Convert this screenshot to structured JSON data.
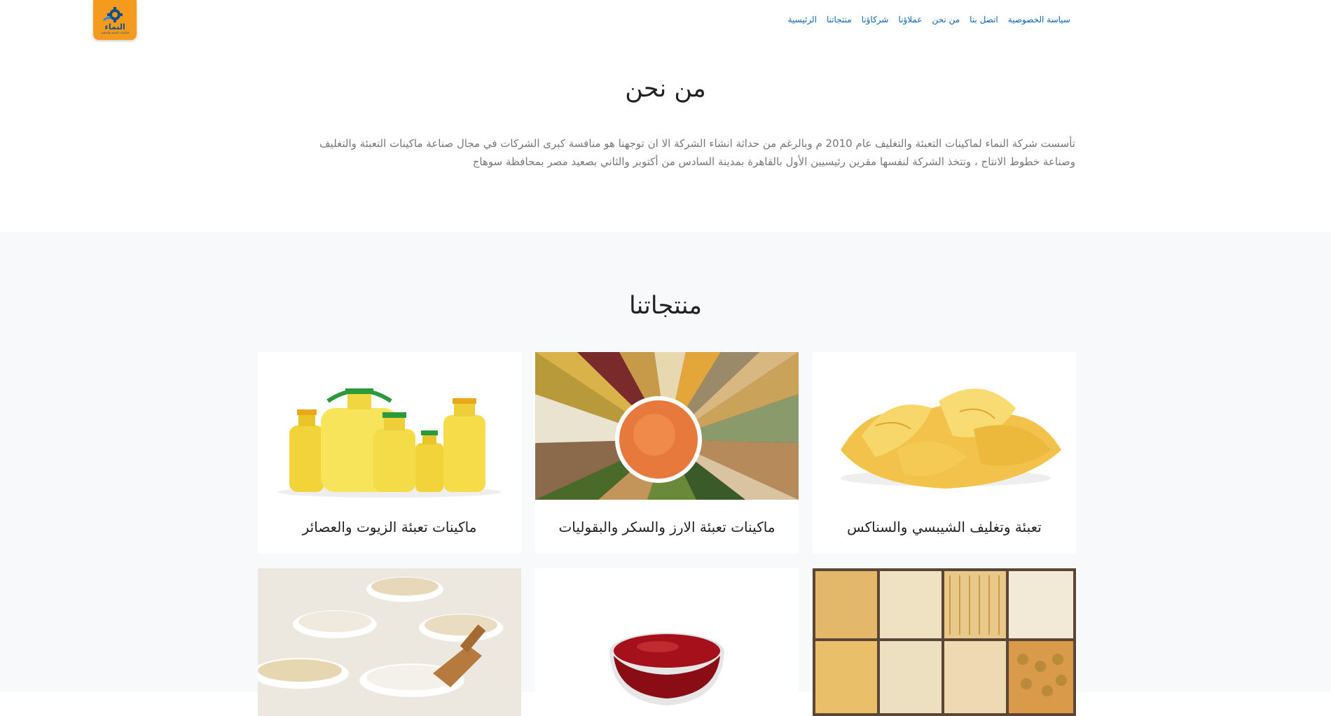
{
  "brand": {
    "logo_text": "النماء",
    "logo_sub": "لماكينات التعبئة والتغليف",
    "colors": {
      "logo_bg": "#f49a1d",
      "nav_link": "#0b67b5",
      "products_bg": "#f8f9fa"
    }
  },
  "nav": {
    "items": [
      {
        "label": "الرئيسية"
      },
      {
        "label": "منتجاتنا"
      },
      {
        "label": "شركاؤنا"
      },
      {
        "label": "عملاؤنا"
      },
      {
        "label": "من نحن"
      },
      {
        "label": "اتصل بنا"
      },
      {
        "label": "سياسة الخصوصية"
      }
    ]
  },
  "about": {
    "title": "من نحن",
    "text": "تأسست شركة النماء لماكينات التعبئة والتغليف عام 2010 م وبالرغم من حداثة انشاء الشركة الا ان توجهنا هو منافسة كبرى الشركات في مجال صناعة ماكينات التعبئة والتغليف وصناعة خطوط الانتاج ، وتتخذ الشركة لنفسها مقرين رئيسيين الأول بالقاهرة بمدينة السادس من أكتوبر والثاني بصعيد مصر بمحافظة سوهاج"
  },
  "products": {
    "title": "منتجاتنا",
    "items": [
      {
        "label": "تعبئة وتغليف الشيبسي والسناكس",
        "image_icon": "potato-chips-image"
      },
      {
        "label": "ماكينات تعبئة الارز والسكر والبقوليات",
        "image_icon": "grains-legumes-image"
      },
      {
        "label": "ماكينات تعبئة الزيوت والعصائر",
        "image_icon": "oil-bottles-image"
      },
      {
        "label": "",
        "image_icon": "pasta-image"
      },
      {
        "label": "",
        "image_icon": "ketchup-bowl-image"
      },
      {
        "label": "",
        "image_icon": "flour-bowls-image"
      }
    ]
  }
}
